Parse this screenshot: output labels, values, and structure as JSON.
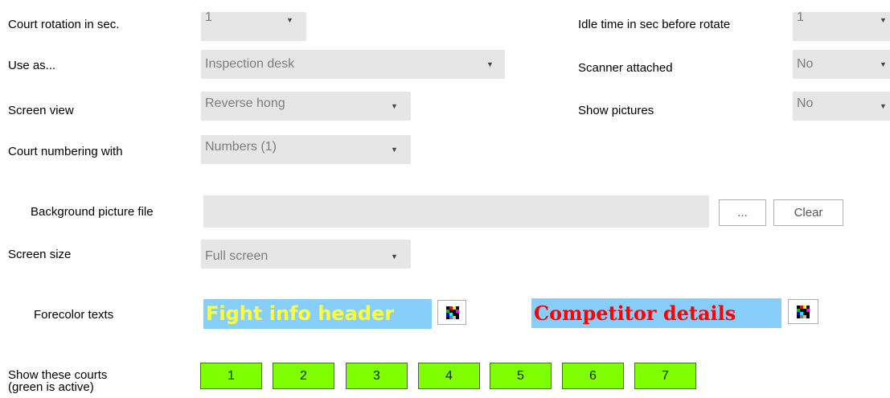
{
  "settings": {
    "court_rotation": {
      "label": "Court rotation in sec.",
      "value": "1"
    },
    "use_as": {
      "label": "Use as...",
      "value": "Inspection desk"
    },
    "screen_view": {
      "label": "Screen view",
      "value": "Reverse hong"
    },
    "court_numbering": {
      "label": "Court numbering with",
      "value": "Numbers (1)"
    },
    "idle_time": {
      "label": "Idle time in sec before rotate",
      "value": "1"
    },
    "scanner_attached": {
      "label": "Scanner attached",
      "value": "No"
    },
    "show_pictures": {
      "label": "Show pictures",
      "value": "No"
    },
    "background_picture": {
      "label": "Background picture file",
      "value": "",
      "browse_label": "...",
      "clear_label": "Clear"
    },
    "screen_size": {
      "label": "Screen size",
      "value": "Full screen"
    }
  },
  "forecolor": {
    "label": "Forecolor texts",
    "fight_info": {
      "text": "Fight info header",
      "color": "#ffff33",
      "background": "#87cefa"
    },
    "competitor": {
      "text": "Competitor details",
      "color": "#ff0000",
      "background": "#87cefa"
    }
  },
  "courts": {
    "label_line1": "Show these courts",
    "label_line2": "(green is active)",
    "active_color": "#80ff00",
    "items": [
      "1",
      "2",
      "3",
      "4",
      "5",
      "6",
      "7"
    ]
  },
  "icons": {
    "dropdown": "triangle-down",
    "color_picker": "color-palette-icon"
  }
}
